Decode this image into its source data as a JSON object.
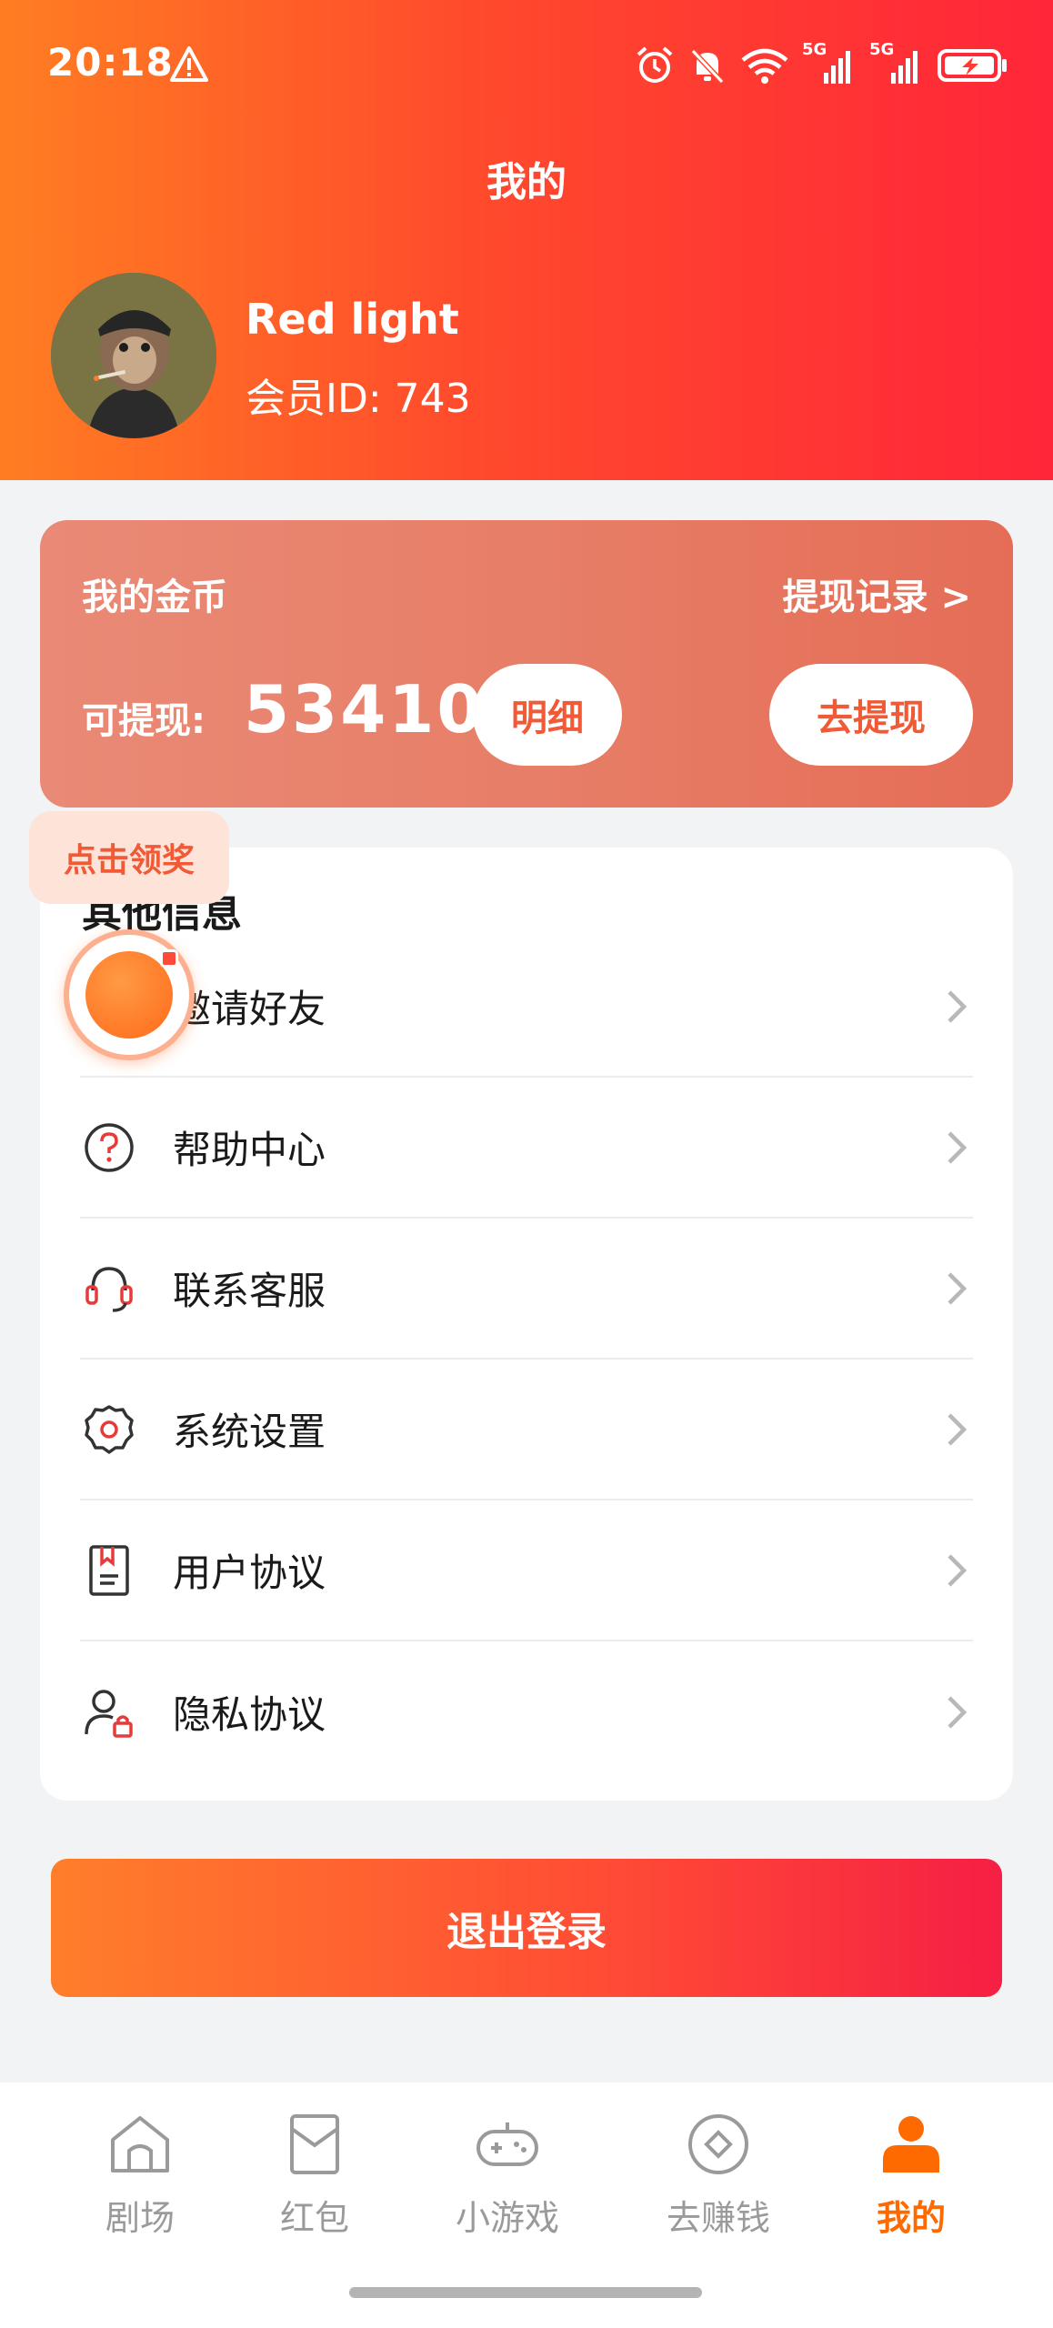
{
  "status_bar": {
    "time": "20:18",
    "network_label_1": "5G",
    "network_label_2": "5G"
  },
  "header": {
    "title": "我的",
    "user_name": "Red light",
    "member_id": "会员ID: 743"
  },
  "coin_card": {
    "title": "我的金币",
    "withdraw_record": "提现记录 >",
    "withdrawable_label": "可提现:",
    "amount": "53410",
    "detail_button": "明细",
    "withdraw_button": "去提现"
  },
  "reward": {
    "badge_label": "点击领奖"
  },
  "info_section": {
    "title": "其他信息",
    "items": [
      {
        "label": "邀请好友",
        "icon": "invite-icon"
      },
      {
        "label": "帮助中心",
        "icon": "help-icon"
      },
      {
        "label": "联系客服",
        "icon": "headset-icon"
      },
      {
        "label": "系统设置",
        "icon": "settings-icon"
      },
      {
        "label": "用户协议",
        "icon": "agreement-icon"
      },
      {
        "label": "隐私协议",
        "icon": "privacy-icon"
      }
    ]
  },
  "logout": {
    "label": "退出登录"
  },
  "bottom_nav": {
    "items": [
      {
        "label": "剧场",
        "icon": "home-icon"
      },
      {
        "label": "红包",
        "icon": "red-packet-icon"
      },
      {
        "label": "小游戏",
        "icon": "gamepad-icon"
      },
      {
        "label": "去赚钱",
        "icon": "coin-icon"
      },
      {
        "label": "我的",
        "icon": "profile-icon",
        "active": true
      }
    ]
  },
  "colors": {
    "accent": "#ff6a00",
    "header_gradient_start": "#ff7d22",
    "header_gradient_end": "#ff2639",
    "button_text": "#f05a37"
  }
}
